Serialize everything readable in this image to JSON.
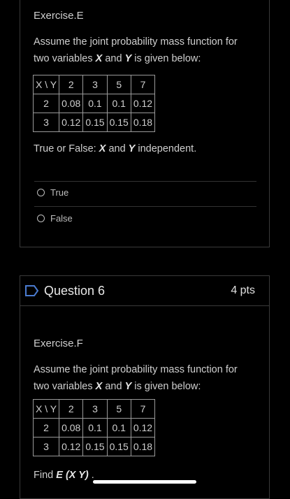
{
  "q5": {
    "exercise_title": "Exercise.E",
    "prompt_line1": "Assume the joint probability mass function for",
    "prompt_line2_pre": "two variables ",
    "var_x": "X",
    "and": " and ",
    "var_y": "Y",
    "prompt_line2_post": " is given below:",
    "table": {
      "corner": "X \\ Y",
      "y_values": [
        "2",
        "3",
        "5",
        "7"
      ],
      "rows": [
        {
          "x": "2",
          "cells": [
            "0.08",
            "0.1",
            "0.1",
            "0.12"
          ]
        },
        {
          "x": "3",
          "cells": [
            "0.12",
            "0.15",
            "0.15",
            "0.18"
          ]
        }
      ]
    },
    "question_pre": "True or False: ",
    "question_x": "X",
    "question_and": " and ",
    "question_y": "Y",
    "question_post": " independent.",
    "options": [
      "True",
      "False"
    ]
  },
  "q6": {
    "header_title": "Question 6",
    "points": "4 pts",
    "exercise_title": "Exercise.F",
    "prompt_line1": "Assume the joint probability mass function for",
    "prompt_line2_pre": "two variables ",
    "var_x": "X",
    "and": " and ",
    "var_y": "Y",
    "prompt_line2_post": " is given below:",
    "table": {
      "corner": "X \\ Y",
      "y_values": [
        "2",
        "3",
        "5",
        "7"
      ],
      "rows": [
        {
          "x": "2",
          "cells": [
            "0.08",
            "0.1",
            "0.1",
            "0.12"
          ]
        },
        {
          "x": "3",
          "cells": [
            "0.12",
            "0.15",
            "0.15",
            "0.18"
          ]
        }
      ]
    },
    "find_pre": "Find ",
    "find_expr": "E (X Y)",
    "find_post": " ."
  },
  "colors": {
    "background": "#000000",
    "border": "#3a3a3a",
    "flag_accent": "#4a7bd0"
  }
}
